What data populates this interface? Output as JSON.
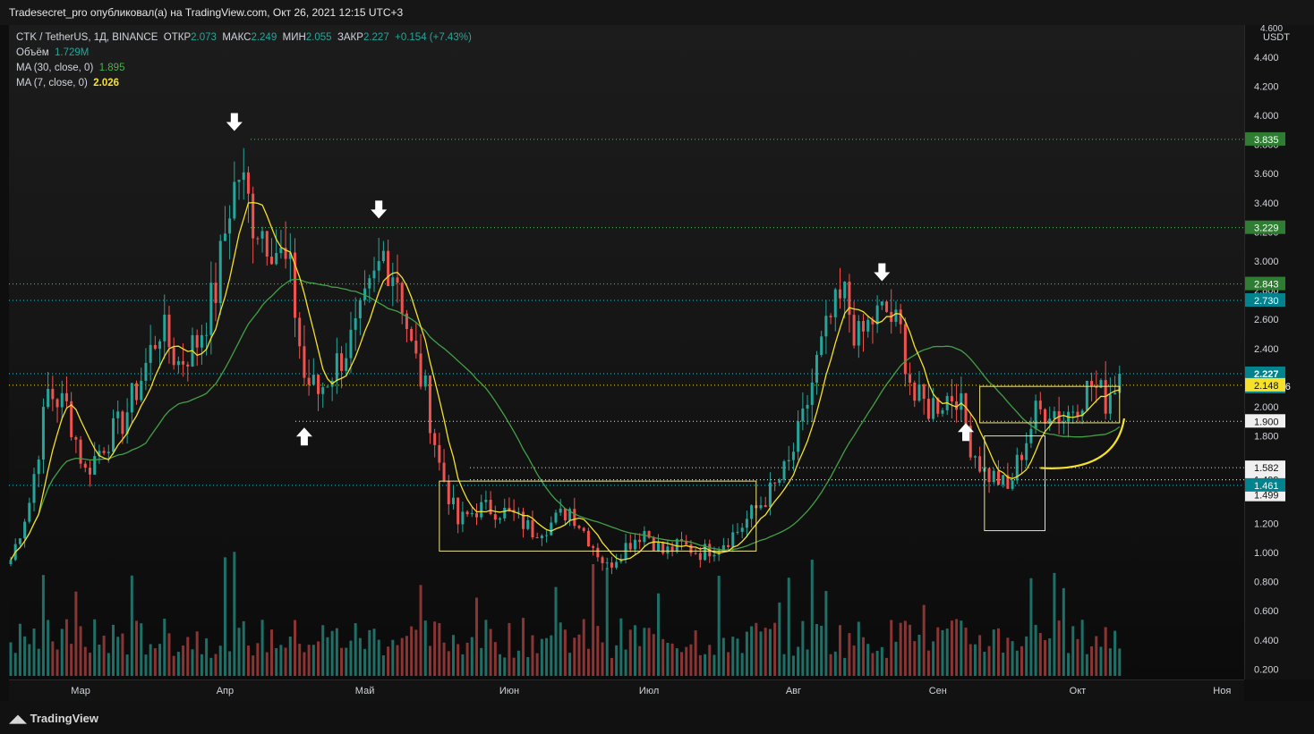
{
  "header": {
    "publisher_line": "Tradesecret_pro опубликовал(а) на TradingView.com, Окт 26, 2021 12:15 UTC+3"
  },
  "legend": {
    "symbol": "CTK / TetherUS, 1Д, BINANCE",
    "open_label": "ОТКР",
    "open": "2.073",
    "high_label": "МАКС",
    "high": "2.249",
    "low_label": "МИН",
    "low": "2.055",
    "close_label": "ЗАКР",
    "close": "2.227",
    "change": "+0.154 (+7.43%)",
    "volume_label": "Объём",
    "volume": "1.729M",
    "ma30_label": "MA (30, close, 0)",
    "ma30": "1.895",
    "ma7_label": "MA (7, close, 0)",
    "ma7": "2.026"
  },
  "price_axis": {
    "unit": "USDT",
    "top_partial_label": "4.600"
  },
  "footer": {
    "brand": "TradingView"
  },
  "colors": {
    "up": "#26a69a",
    "down": "#ef5350",
    "ma7": "#f5e12a",
    "ma30": "#43a047",
    "box": "#f0e68c",
    "level": "#66bb6a",
    "cyan_level": "#26c6da"
  },
  "chart_data": {
    "type": "candlestick",
    "title": "",
    "xlabel": "",
    "ylabel": "USDT",
    "ylim": [
      0.1,
      4.6
    ],
    "yticks": [
      0.2,
      0.4,
      0.6,
      0.8,
      1.0,
      1.2,
      1.4,
      1.6,
      1.8,
      2.0,
      2.2,
      2.4,
      2.6,
      2.8,
      3.0,
      3.2,
      3.4,
      3.6,
      3.8,
      4.0,
      4.2,
      4.4
    ],
    "ytick_labels": [
      "0.200",
      "0.400",
      "0.600",
      "0.800",
      "1.000",
      "1.200",
      "1.400",
      "1.600",
      "1.800",
      "2.000",
      "2.200",
      "2.400",
      "2.600",
      "2.800",
      "3.000",
      "3.200",
      "3.400",
      "3.600",
      "3.800",
      "4.000",
      "4.200",
      "4.400"
    ],
    "x_range_days": [
      0,
      270
    ],
    "month_ticks": [
      {
        "label": "Мар",
        "day": 15
      },
      {
        "label": "Апр",
        "day": 46
      },
      {
        "label": "Май",
        "day": 76
      },
      {
        "label": "Июн",
        "day": 107
      },
      {
        "label": "Июл",
        "day": 137
      },
      {
        "label": "Авг",
        "day": 168
      },
      {
        "label": "Сен",
        "day": 199
      },
      {
        "label": "Окт",
        "day": 229
      },
      {
        "label": "Ноя",
        "day": 260
      }
    ],
    "price_path": [
      {
        "day": 0,
        "close": 0.95
      },
      {
        "day": 4,
        "close": 1.35
      },
      {
        "day": 8,
        "close": 2.1
      },
      {
        "day": 12,
        "close": 2.0
      },
      {
        "day": 16,
        "close": 1.55
      },
      {
        "day": 20,
        "close": 1.75
      },
      {
        "day": 24,
        "close": 1.9
      },
      {
        "day": 28,
        "close": 2.2
      },
      {
        "day": 32,
        "close": 2.55
      },
      {
        "day": 36,
        "close": 2.3
      },
      {
        "day": 40,
        "close": 2.45
      },
      {
        "day": 44,
        "close": 2.8
      },
      {
        "day": 47,
        "close": 3.4
      },
      {
        "day": 49,
        "close": 3.6
      },
      {
        "day": 52,
        "close": 3.3
      },
      {
        "day": 56,
        "close": 3.15
      },
      {
        "day": 60,
        "close": 2.9
      },
      {
        "day": 63,
        "close": 2.2
      },
      {
        "day": 66,
        "close": 2.1
      },
      {
        "day": 70,
        "close": 2.3
      },
      {
        "day": 74,
        "close": 2.5
      },
      {
        "day": 78,
        "close": 2.85
      },
      {
        "day": 80,
        "close": 3.05
      },
      {
        "day": 83,
        "close": 2.9
      },
      {
        "day": 86,
        "close": 2.4
      },
      {
        "day": 89,
        "close": 2.1
      },
      {
        "day": 92,
        "close": 1.6
      },
      {
        "day": 96,
        "close": 1.2
      },
      {
        "day": 100,
        "close": 1.3
      },
      {
        "day": 104,
        "close": 1.3
      },
      {
        "day": 108,
        "close": 1.25
      },
      {
        "day": 112,
        "close": 1.15
      },
      {
        "day": 116,
        "close": 1.2
      },
      {
        "day": 120,
        "close": 1.3
      },
      {
        "day": 124,
        "close": 1.1
      },
      {
        "day": 128,
        "close": 0.9
      },
      {
        "day": 132,
        "close": 1.05
      },
      {
        "day": 136,
        "close": 1.15
      },
      {
        "day": 140,
        "close": 1.0
      },
      {
        "day": 144,
        "close": 1.05
      },
      {
        "day": 148,
        "close": 1.0
      },
      {
        "day": 152,
        "close": 1.05
      },
      {
        "day": 156,
        "close": 1.15
      },
      {
        "day": 160,
        "close": 1.3
      },
      {
        "day": 164,
        "close": 1.45
      },
      {
        "day": 167,
        "close": 1.6
      },
      {
        "day": 170,
        "close": 1.9
      },
      {
        "day": 173,
        "close": 2.3
      },
      {
        "day": 176,
        "close": 2.6
      },
      {
        "day": 179,
        "close": 2.75
      },
      {
        "day": 182,
        "close": 2.45
      },
      {
        "day": 185,
        "close": 2.6
      },
      {
        "day": 188,
        "close": 2.65
      },
      {
        "day": 191,
        "close": 2.5
      },
      {
        "day": 194,
        "close": 2.05
      },
      {
        "day": 197,
        "close": 2.0
      },
      {
        "day": 200,
        "close": 2.05
      },
      {
        "day": 203,
        "close": 2.1
      },
      {
        "day": 206,
        "close": 1.75
      },
      {
        "day": 209,
        "close": 1.55
      },
      {
        "day": 212,
        "close": 1.5
      },
      {
        "day": 214,
        "close": 1.42
      },
      {
        "day": 217,
        "close": 1.7
      },
      {
        "day": 220,
        "close": 1.95
      },
      {
        "day": 223,
        "close": 2.0
      },
      {
        "day": 226,
        "close": 1.92
      },
      {
        "day": 229,
        "close": 2.05
      },
      {
        "day": 232,
        "close": 2.15
      },
      {
        "day": 235,
        "close": 2.05
      },
      {
        "day": 238,
        "close": 2.227
      }
    ],
    "ma7_color": "#f5e12a",
    "ma30_color": "#43a047",
    "horizontal_levels": [
      {
        "price": 3.835,
        "label": "3.835",
        "style": "green-dotted"
      },
      {
        "price": 3.229,
        "label": "3.229",
        "style": "green-dotted"
      },
      {
        "price": 2.843,
        "label": "2.843",
        "style": "green-dotted"
      },
      {
        "price": 2.73,
        "label": "2.730",
        "style": "cyan-dotted"
      },
      {
        "price": 2.227,
        "label": "2.227",
        "style": "cyan-dotted",
        "countdown": "14:44:36"
      },
      {
        "price": 2.148,
        "label": "2.148",
        "style": "yellow-dotted"
      },
      {
        "price": 1.9,
        "label": "1.900",
        "style": "white-dotted"
      },
      {
        "price": 1.582,
        "label": "1.582",
        "style": "white-dotted"
      },
      {
        "price": 1.499,
        "label": "1.499",
        "style": "white-dotted"
      },
      {
        "price": 1.499,
        "label": "1.499",
        "style": "white-dotted"
      },
      {
        "price": 1.461,
        "label": "1.461",
        "style": "cyan-dotted"
      }
    ],
    "boxes": [
      {
        "day_from": 92,
        "day_to": 160,
        "price_from": 1.01,
        "price_to": 1.49
      },
      {
        "day_from": 208,
        "day_to": 238,
        "price_from": 1.89,
        "price_to": 2.14
      },
      {
        "day_from": 209,
        "day_to": 222,
        "price_from": 1.15,
        "price_to": 1.8
      }
    ],
    "arrows": [
      {
        "day": 48,
        "price": 3.88,
        "direction": "down"
      },
      {
        "day": 63,
        "price": 1.87,
        "direction": "up"
      },
      {
        "day": 79,
        "price": 3.28,
        "direction": "down"
      },
      {
        "day": 187,
        "price": 2.85,
        "direction": "down"
      },
      {
        "day": 205,
        "price": 1.9,
        "direction": "up"
      }
    ],
    "curve": {
      "from_day": 221,
      "to_day": 239,
      "price_from": 1.58,
      "price_to": 1.92
    }
  }
}
